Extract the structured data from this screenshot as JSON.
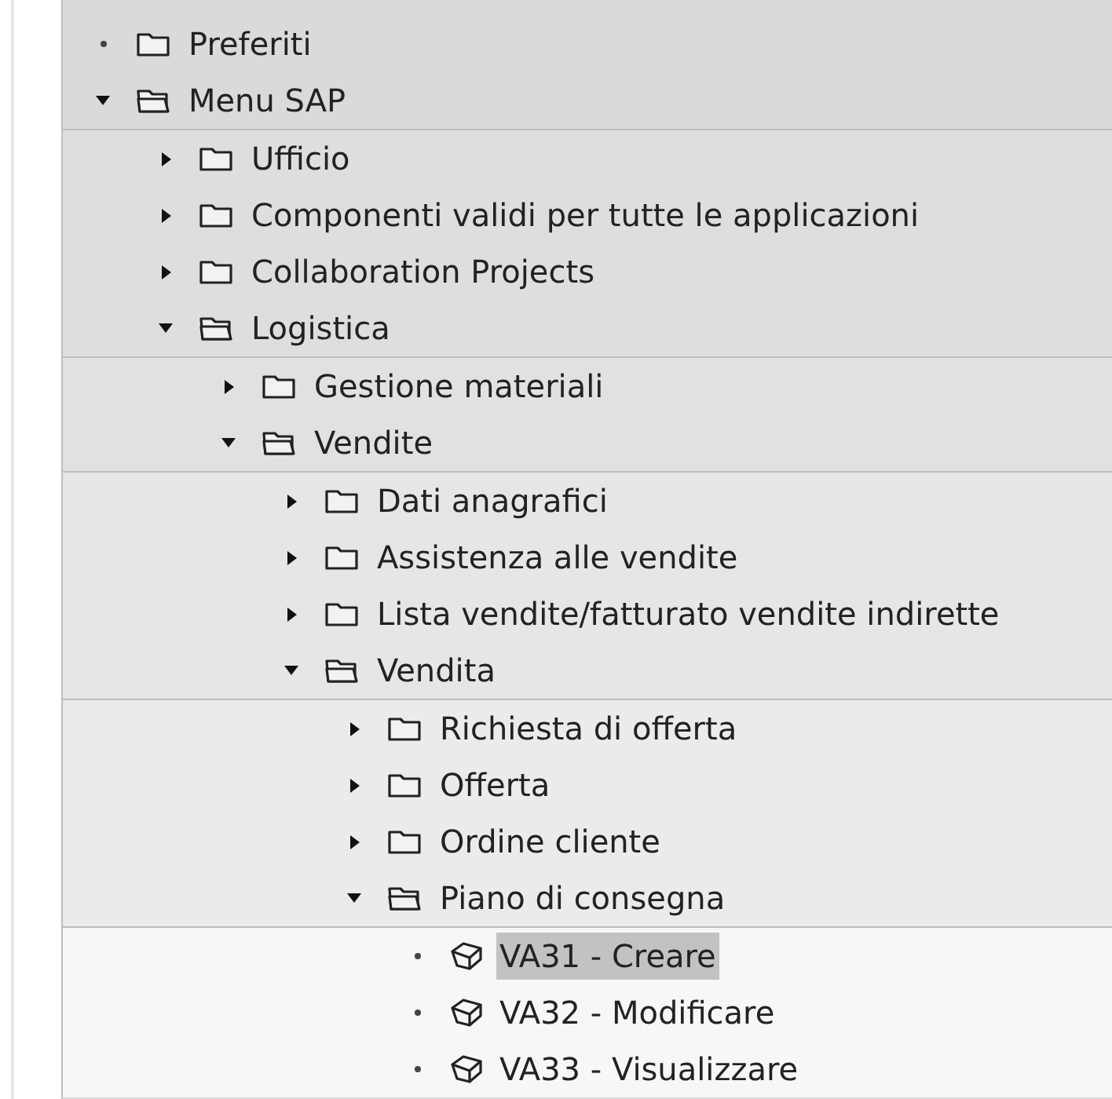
{
  "tree": [
    {
      "label": "Preferiti",
      "kind": "folder",
      "selected": false
    },
    {
      "label": "Menu SAP",
      "kind": "folder",
      "selected": false,
      "expanded": true,
      "children": [
        {
          "label": "Ufficio",
          "kind": "folder",
          "selected": false,
          "expanded": false
        },
        {
          "label": "Componenti validi per tutte le applicazioni",
          "kind": "folder",
          "selected": false,
          "expanded": false
        },
        {
          "label": "Collaboration Projects",
          "kind": "folder",
          "selected": false,
          "expanded": false
        },
        {
          "label": "Logistica",
          "kind": "folder",
          "selected": false,
          "expanded": true,
          "children": [
            {
              "label": "Gestione materiali",
              "kind": "folder",
              "selected": false,
              "expanded": false
            },
            {
              "label": "Vendite",
              "kind": "folder",
              "selected": false,
              "expanded": true,
              "children": [
                {
                  "label": "Dati anagrafici",
                  "kind": "folder",
                  "selected": false,
                  "expanded": false
                },
                {
                  "label": "Assistenza alle vendite",
                  "kind": "folder",
                  "selected": false,
                  "expanded": false
                },
                {
                  "label": "Lista vendite/fatturato vendite indirette",
                  "kind": "folder",
                  "selected": false,
                  "expanded": false
                },
                {
                  "label": "Vendita",
                  "kind": "folder",
                  "selected": false,
                  "expanded": true,
                  "children": [
                    {
                      "label": "Richiesta di offerta",
                      "kind": "folder",
                      "selected": false,
                      "expanded": false
                    },
                    {
                      "label": "Offerta",
                      "kind": "folder",
                      "selected": false,
                      "expanded": false
                    },
                    {
                      "label": "Ordine cliente",
                      "kind": "folder",
                      "selected": false,
                      "expanded": false
                    },
                    {
                      "label": "Piano di consegna",
                      "kind": "folder",
                      "selected": false,
                      "expanded": true,
                      "children": [
                        {
                          "label": "VA31 - Creare",
                          "kind": "transaction",
                          "selected": true
                        },
                        {
                          "label": "VA32 - Modificare",
                          "kind": "transaction",
                          "selected": false
                        },
                        {
                          "label": "VA33 - Visualizzare",
                          "kind": "transaction",
                          "selected": false
                        }
                      ]
                    }
                  ]
                }
              ]
            }
          ]
        }
      ]
    }
  ]
}
